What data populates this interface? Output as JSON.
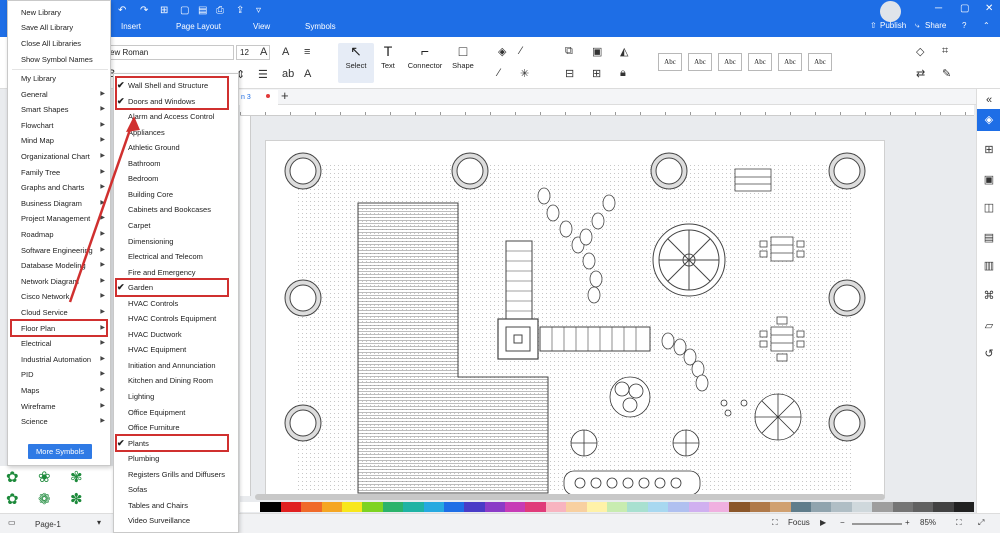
{
  "titlebar": {
    "undo_icon": "undo-icon",
    "redo_icon": "redo-icon",
    "tabs": [
      "Insert",
      "Page Layout",
      "View",
      "Symbols"
    ],
    "publish": "Publish",
    "share": "Share"
  },
  "ribbon": {
    "font_name": "ew Roman",
    "font_size": "12",
    "tools": [
      {
        "label": "Select",
        "icon": "pointer-icon"
      },
      {
        "label": "Text",
        "icon": "text-T-icon"
      },
      {
        "label": "Connector",
        "icon": "connector-icon"
      },
      {
        "label": "Shape",
        "icon": "square-icon"
      }
    ],
    "style_labels": [
      "Abc",
      "Abc",
      "Abc",
      "Abc",
      "Abc",
      "Abc"
    ]
  },
  "document": {
    "tab_label": "n 3"
  },
  "library_menu": {
    "top_items": [
      "New Library",
      "Save All Library",
      "Close All Libraries",
      "Show Symbol Names"
    ],
    "categories": [
      "My Library",
      "General",
      "Smart Shapes",
      "Flowchart",
      "Mind Map",
      "Organizational Chart",
      "Family Tree",
      "Graphs and Charts",
      "Business Diagram",
      "Project Management",
      "Roadmap",
      "Software Engineering",
      "Database Modeling",
      "Network Diagram",
      "Cisco Network",
      "Cloud Service",
      "Floor Plan",
      "Electrical",
      "Industrial Automation",
      "PID",
      "Maps",
      "Wireframe",
      "Science"
    ],
    "more_symbols": "More Symbols"
  },
  "floor_plan_menu": {
    "items": [
      {
        "label": "Wall Shell and Structure",
        "checked": true
      },
      {
        "label": "Doors and Windows",
        "checked": true
      },
      {
        "label": "Alarm and Access Control",
        "checked": false
      },
      {
        "label": "Appliances",
        "checked": false
      },
      {
        "label": "Athletic Ground",
        "checked": false
      },
      {
        "label": "Bathroom",
        "checked": false
      },
      {
        "label": "Bedroom",
        "checked": false
      },
      {
        "label": "Building Core",
        "checked": false
      },
      {
        "label": "Cabinets and Bookcases",
        "checked": false
      },
      {
        "label": "Carpet",
        "checked": false
      },
      {
        "label": "Dimensioning",
        "checked": false
      },
      {
        "label": "Electrical and Telecom",
        "checked": false
      },
      {
        "label": "Fire and Emergency",
        "checked": false
      },
      {
        "label": "Garden",
        "checked": true
      },
      {
        "label": "HVAC Controls",
        "checked": false
      },
      {
        "label": "HVAC Controls Equipment",
        "checked": false
      },
      {
        "label": "HVAC Ductwork",
        "checked": false
      },
      {
        "label": "HVAC Equipment",
        "checked": false
      },
      {
        "label": "Initiation and Annunciation",
        "checked": false
      },
      {
        "label": "Kitchen and Dining Room",
        "checked": false
      },
      {
        "label": "Lighting",
        "checked": false
      },
      {
        "label": "Office Equipment",
        "checked": false
      },
      {
        "label": "Office Furniture",
        "checked": false
      },
      {
        "label": "Plants",
        "checked": true
      },
      {
        "label": "Plumbing",
        "checked": false
      },
      {
        "label": "Registers Grills and Diffusers",
        "checked": false
      },
      {
        "label": "Sofas",
        "checked": false
      },
      {
        "label": "Tables and Chairs",
        "checked": false
      },
      {
        "label": "Video Surveillance",
        "checked": false
      }
    ]
  },
  "status": {
    "page_label": "Page-1",
    "focus": "Focus",
    "zoom": "85%"
  },
  "colors": {
    "accent": "#1e6ee6",
    "highlight": "#d0302f"
  }
}
